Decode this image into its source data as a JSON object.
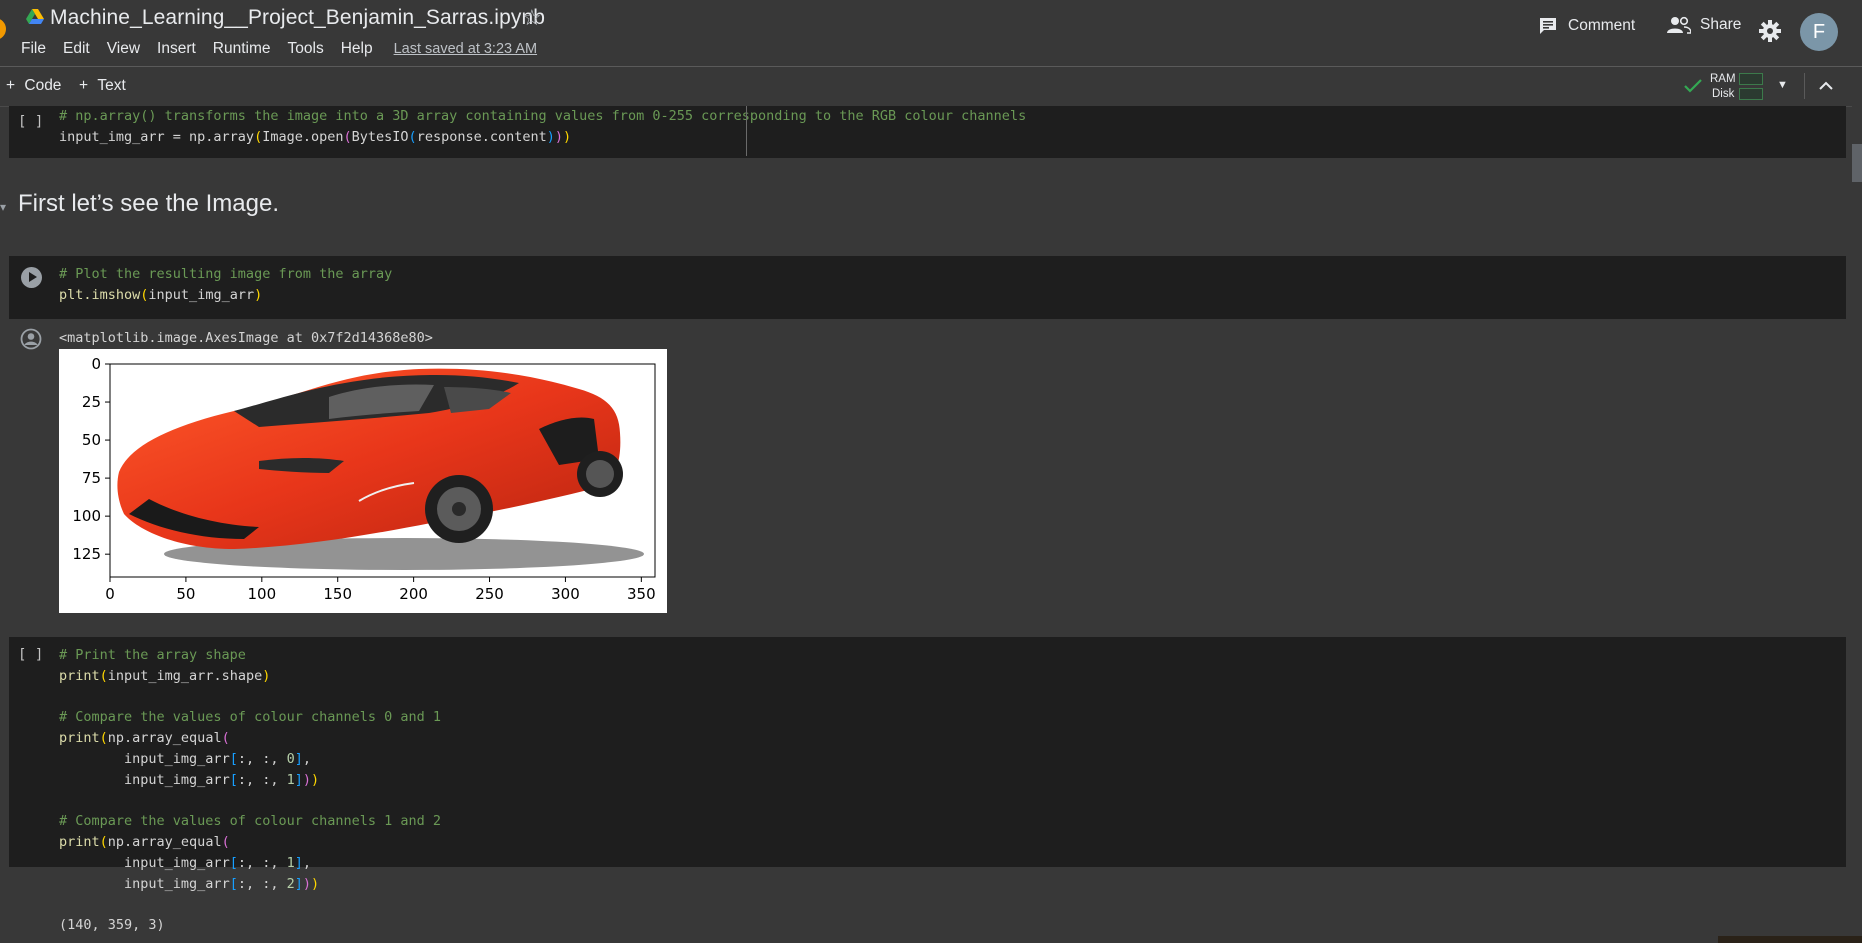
{
  "header": {
    "doc_title": "Machine_Learning__Project_Benjamin_Sarras.ipynb",
    "menu": [
      "File",
      "Edit",
      "View",
      "Insert",
      "Runtime",
      "Tools",
      "Help"
    ],
    "last_saved": "Last saved at 3:23 AM",
    "comment_label": "Comment",
    "share_label": "Share",
    "avatar_initial": "F"
  },
  "toolbar": {
    "code_label": "Code",
    "text_label": "Text",
    "ram_label": "RAM",
    "disk_label": "Disk"
  },
  "cells": {
    "c1": {
      "bracket": "[ ]",
      "comment": "# np.array() transforms the image into a 3D array containing values from 0-255 corresponding to the RGB colour channels",
      "line2_a": "input_img_arr = np.array",
      "line2_b": "Image.open",
      "line2_c": "BytesIO",
      "line2_d": "response.content"
    },
    "heading": "First let’s see the Image.",
    "c2": {
      "comment": "# Plot the resulting image from the array",
      "line2_a": "plt.imshow",
      "line2_b": "input_img_arr",
      "output_text": "<matplotlib.image.AxesImage at 0x7f2d14368e80>"
    },
    "c3": {
      "bracket": "[ ]",
      "comment1": "# Print the array shape",
      "print": "print",
      "shape_arg": "input_img_arr.shape",
      "comment2": "# Compare the values of colour channels 0 and 1",
      "eq": "np.array_equal",
      "arr": "input_img_arr",
      "idx0": ":, :, ",
      "n0": "0",
      "n1": "1",
      "n2": "2",
      "comment3": "# Compare the values of colour channels 1 and 2",
      "output_text": "(140, 359, 3)"
    }
  },
  "chart_data": {
    "type": "image",
    "xticks": [
      0,
      50,
      100,
      150,
      200,
      250,
      300,
      350
    ],
    "yticks": [
      0,
      25,
      50,
      75,
      100,
      125
    ],
    "xlim": [
      0,
      359
    ],
    "ylim": [
      140,
      0
    ]
  }
}
